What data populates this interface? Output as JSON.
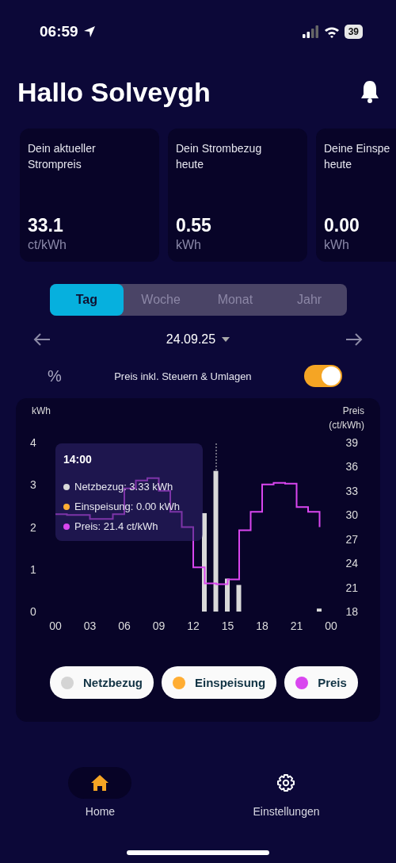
{
  "status_bar": {
    "time": "06:59",
    "battery": "39"
  },
  "header": {
    "title": "Hallo Solveygh"
  },
  "stat_cards": [
    {
      "label_lines": [
        "Dein aktueller",
        "Strompreis"
      ],
      "value": "33.1",
      "unit": "ct/kWh"
    },
    {
      "label_lines": [
        "Dein Strombezug",
        "heute"
      ],
      "value": "0.55",
      "unit": "kWh"
    },
    {
      "label_lines": [
        "Deine Einspe",
        "heute"
      ],
      "value": "0.00",
      "unit": "kWh"
    }
  ],
  "period_tabs": [
    {
      "label": "Tag",
      "selected": true
    },
    {
      "label": "Woche",
      "selected": false
    },
    {
      "label": "Monat",
      "selected": false
    },
    {
      "label": "Jahr",
      "selected": false
    }
  ],
  "date_nav": {
    "date": "24.09.25"
  },
  "price_toggle": {
    "symbol": "%",
    "label": "Preis inkl. Steuern & Umlagen",
    "on": true
  },
  "chart": {
    "tooltip": {
      "title": "14:00",
      "rows": [
        {
          "text": "Netzbezug: 3.33 kWh",
          "color": "#d9d9d9"
        },
        {
          "text": "Einspeisung: 0.00 kWh",
          "color": "#ffad33"
        },
        {
          "text": "Preis: 21.4 ct/kWh",
          "color": "#d946ef"
        }
      ]
    },
    "energy": {
      "chart_data": {
        "type": "bar",
        "ylabel": "kWh",
        "x": [
          13,
          14,
          15,
          16,
          23
        ],
        "xlim": [
          0,
          24
        ],
        "xticks": [
          {
            "value": 0,
            "label": "00"
          },
          {
            "value": 3,
            "label": "03"
          },
          {
            "value": 6,
            "label": "06"
          },
          {
            "value": 9,
            "label": "09"
          },
          {
            "value": 12,
            "label": "12"
          },
          {
            "value": 15,
            "label": "15"
          },
          {
            "value": 18,
            "label": "18"
          },
          {
            "value": 21,
            "label": "21"
          },
          {
            "value": 24,
            "label": "00"
          }
        ],
        "ylim": [
          0,
          4
        ],
        "yticks": [
          0,
          1,
          2,
          3,
          4
        ],
        "ref_lines": [
          {
            "axis": "x",
            "value": 14
          }
        ],
        "series": [
          {
            "color": "#d9d9d9",
            "values": [
              2.33,
              3.33,
              0.78,
              0.63,
              0.07
            ]
          }
        ]
      }
    },
    "price": {
      "chart_data": {
        "type": "line",
        "ylabel": "Preis (ct/kWh)",
        "x": [
          0,
          1,
          1,
          2,
          2,
          3,
          3,
          4,
          4,
          5,
          5,
          6,
          6,
          7,
          7,
          8,
          8,
          9,
          9,
          10,
          10,
          11,
          11,
          12,
          12,
          13,
          13,
          14,
          14,
          15,
          15,
          16,
          16,
          17,
          17,
          18,
          18,
          19,
          19,
          20,
          20,
          21,
          21,
          22,
          22,
          23,
          23
        ],
        "xlim": [
          0,
          24
        ],
        "ylim": [
          18,
          39
        ],
        "yticks": [
          18,
          21,
          24,
          27,
          30,
          33,
          36,
          39
        ],
        "series": [
          {
            "color": "#d946ef",
            "values": [
              30.1,
              30.1,
              30.0,
              30.0,
              30.0,
              30.0,
              29.5,
              29.5,
              29.5,
              29.5,
              30.1,
              30.1,
              33.3,
              33.3,
              34.3,
              34.3,
              34.6,
              34.6,
              33.0,
              33.0,
              30.4,
              30.4,
              28.5,
              28.5,
              23.5,
              23.5,
              21.5,
              21.5,
              21.4,
              21.4,
              22.0,
              22.0,
              28.1,
              28.1,
              30.4,
              30.4,
              33.8,
              33.8,
              34.0,
              34.0,
              33.9,
              33.9,
              31.0,
              31.0,
              30.4,
              30.4,
              28.5
            ]
          }
        ]
      }
    }
  },
  "legend": [
    {
      "label": "Netzbezug",
      "color": "#d4d4d4"
    },
    {
      "label": "Einspeisung",
      "color": "#ffad33"
    },
    {
      "label": "Preis",
      "color": "#d946ef"
    }
  ],
  "bottom_nav": [
    {
      "label": "Home",
      "kind": "home",
      "selected": true
    },
    {
      "label": "Einstellungen",
      "kind": "settings",
      "selected": false
    }
  ]
}
